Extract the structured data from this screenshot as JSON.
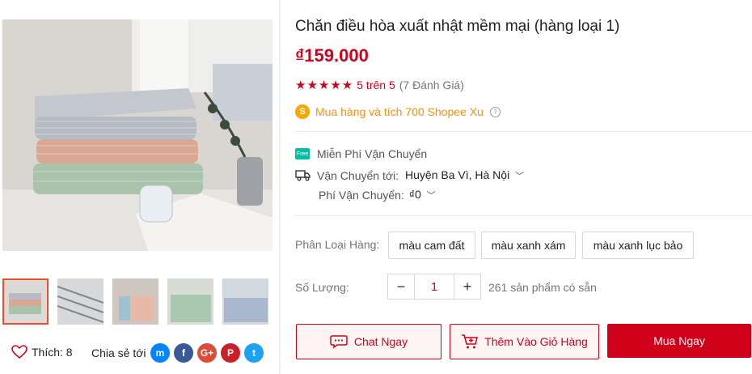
{
  "product": {
    "title": "Chăn điều hòa xuất nhật mềm mại (hàng loại 1)",
    "price": "₫159.000",
    "rating_stars": "★★★★★",
    "rating_text": "5 trên 5",
    "review_count": "(7 Đánh Giá)",
    "rating_value": 5,
    "coins_text": "Mua hàng và tích 700 Shopee Xu"
  },
  "shipping": {
    "free_label": "Miễn Phí Vận Chuyển",
    "free_badge": "Free",
    "to_label": "Vận Chuyển tới:",
    "to_value": "Huyện Ba Vì, Hà Nội",
    "fee_label": "Phí Vận Chuyển:",
    "fee_value": "₫0"
  },
  "variants": {
    "label": "Phân Loại Hàng:",
    "options": [
      "màu cam đất",
      "màu xanh xám",
      "màu xanh lục bảo"
    ]
  },
  "quantity": {
    "label": "Số Lượng:",
    "minus": "−",
    "value": "1",
    "plus": "+",
    "available": "261 sản phẩm có sẵn"
  },
  "actions": {
    "chat": "Chat Ngay",
    "add_cart": "Thêm Vào Giỏ Hàng",
    "buy": "Mua Ngay"
  },
  "social": {
    "like_label": "Thích: 8",
    "share_label": "Chia sẻ tới",
    "icons": [
      "messenger-icon",
      "facebook-icon",
      "google-plus-icon",
      "pinterest-icon",
      "twitter-icon"
    ]
  },
  "colors": {
    "accent": "#d0011b",
    "coin": "#f69113"
  }
}
